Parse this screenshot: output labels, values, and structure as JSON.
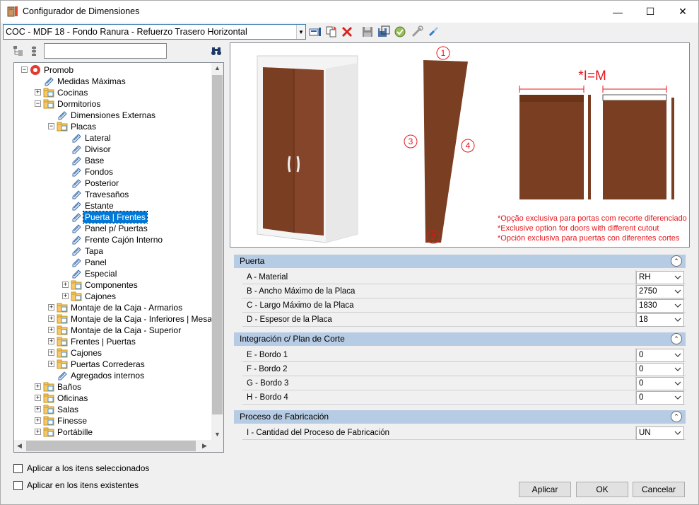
{
  "window": {
    "title": "Configurador de Dimensiones",
    "minimize": "—",
    "maximize": "☐",
    "close": "✕"
  },
  "toolbar": {
    "selector_value": "COC - MDF 18 - Fondo Ranura - Refuerzo Trasero Horizontal",
    "icons": [
      "properties-icon",
      "copy-icon",
      "delete-icon",
      "save-icon",
      "save-as-icon",
      "apply-icon",
      "tools-icon",
      "link-icon"
    ]
  },
  "tree": {
    "search_value": "",
    "items": [
      {
        "label": "Promob",
        "level": 0,
        "expander": "−",
        "icon": "promob-logo-icon"
      },
      {
        "label": "Medidas Máximas",
        "level": 1,
        "expander": "",
        "icon": "pencil-tag-icon"
      },
      {
        "label": "Cocinas",
        "level": 1,
        "expander": "+",
        "icon": "folder-icon"
      },
      {
        "label": "Dormitorios",
        "level": 1,
        "expander": "−",
        "icon": "folder-icon"
      },
      {
        "label": "Dimensiones Externas",
        "level": 2,
        "expander": "",
        "icon": "pencil-tag-icon"
      },
      {
        "label": "Placas",
        "level": 2,
        "expander": "−",
        "icon": "folder-icon"
      },
      {
        "label": "Lateral",
        "level": 3,
        "expander": "",
        "icon": "pencil-tag-icon"
      },
      {
        "label": "Divisor",
        "level": 3,
        "expander": "",
        "icon": "pencil-tag-icon"
      },
      {
        "label": "Base",
        "level": 3,
        "expander": "",
        "icon": "pencil-tag-icon"
      },
      {
        "label": "Fondos",
        "level": 3,
        "expander": "",
        "icon": "pencil-tag-icon"
      },
      {
        "label": "Posterior",
        "level": 3,
        "expander": "",
        "icon": "pencil-tag-icon"
      },
      {
        "label": "Travesaños",
        "level": 3,
        "expander": "",
        "icon": "pencil-tag-icon"
      },
      {
        "label": "Estante",
        "level": 3,
        "expander": "",
        "icon": "pencil-tag-icon"
      },
      {
        "label": "Puerta | Frentes",
        "level": 3,
        "expander": "",
        "icon": "pencil-tag-icon",
        "selected": true
      },
      {
        "label": "Panel p/ Puertas",
        "level": 3,
        "expander": "",
        "icon": "pencil-tag-icon"
      },
      {
        "label": "Frente Cajón Interno",
        "level": 3,
        "expander": "",
        "icon": "pencil-tag-icon"
      },
      {
        "label": "Tapa",
        "level": 3,
        "expander": "",
        "icon": "pencil-tag-icon"
      },
      {
        "label": "Panel",
        "level": 3,
        "expander": "",
        "icon": "pencil-tag-icon"
      },
      {
        "label": "Especial",
        "level": 3,
        "expander": "",
        "icon": "pencil-tag-icon"
      },
      {
        "label": "Componentes",
        "level": 3,
        "expander": "+",
        "icon": "folder-icon"
      },
      {
        "label": "Cajones",
        "level": 3,
        "expander": "+",
        "icon": "folder-icon"
      },
      {
        "label": "Montaje de la Caja - Armarios",
        "level": 2,
        "expander": "+",
        "icon": "folder-icon"
      },
      {
        "label": "Montaje de la Caja - Inferiores | Mesa de N",
        "level": 2,
        "expander": "+",
        "icon": "folder-icon"
      },
      {
        "label": "Montaje de la Caja - Superior",
        "level": 2,
        "expander": "+",
        "icon": "folder-icon"
      },
      {
        "label": "Frentes | Puertas",
        "level": 2,
        "expander": "+",
        "icon": "folder-icon"
      },
      {
        "label": "Cajones",
        "level": 2,
        "expander": "+",
        "icon": "folder-icon"
      },
      {
        "label": "Puertas Correderas",
        "level": 2,
        "expander": "+",
        "icon": "folder-icon"
      },
      {
        "label": "Agregados internos",
        "level": 2,
        "expander": "",
        "icon": "pencil-tag-icon"
      },
      {
        "label": "Baños",
        "level": 1,
        "expander": "+",
        "icon": "folder-icon"
      },
      {
        "label": "Oficinas",
        "level": 1,
        "expander": "+",
        "icon": "folder-icon"
      },
      {
        "label": "Salas",
        "level": 1,
        "expander": "+",
        "icon": "folder-icon"
      },
      {
        "label": "Finesse",
        "level": 1,
        "expander": "+",
        "icon": "folder-icon"
      },
      {
        "label": "Portábille",
        "level": 1,
        "expander": "+",
        "icon": "folder-icon"
      }
    ]
  },
  "options": {
    "apply_selected": "Aplicar a los itens seleccionados",
    "apply_existing": "Aplicar en los itens existentes"
  },
  "preview": {
    "formula": "*I=M",
    "edge_markers": [
      "1",
      "2",
      "3",
      "4"
    ],
    "notes": [
      "*Opção exclusiva para portas com recorte diferenciado",
      "*Exclusive option for doors with different cutout",
      "*Opción exclusiva para puertas con diferentes cortes"
    ],
    "colors": {
      "wood": "#7a3e22",
      "note_red": "#e8141a",
      "section_blue": "#b6cbe4"
    }
  },
  "properties": {
    "sections": [
      {
        "title": "Puerta",
        "rows": [
          {
            "label": "A - Material",
            "value": "RH"
          },
          {
            "label": "B -  Ancho Máximo de la Placa",
            "value": "2750"
          },
          {
            "label": "C - Largo Máximo de la Placa",
            "value": "1830"
          },
          {
            "label": "D - Espesor de la Placa",
            "value": "18"
          }
        ]
      },
      {
        "title": "Integración c/ Plan de Corte",
        "rows": [
          {
            "label": "E - Bordo 1",
            "value": "0"
          },
          {
            "label": "F - Bordo 2",
            "value": "0"
          },
          {
            "label": "G - Bordo 3",
            "value": "0"
          },
          {
            "label": "H - Bordo 4",
            "value": "0"
          }
        ]
      },
      {
        "title": "Proceso de Fabricación",
        "rows": [
          {
            "label": "I - Cantidad del Proceso de Fabricación",
            "value": "UN"
          }
        ]
      }
    ]
  },
  "buttons": {
    "apply": "Aplicar",
    "ok": "OK",
    "cancel": "Cancelar"
  }
}
